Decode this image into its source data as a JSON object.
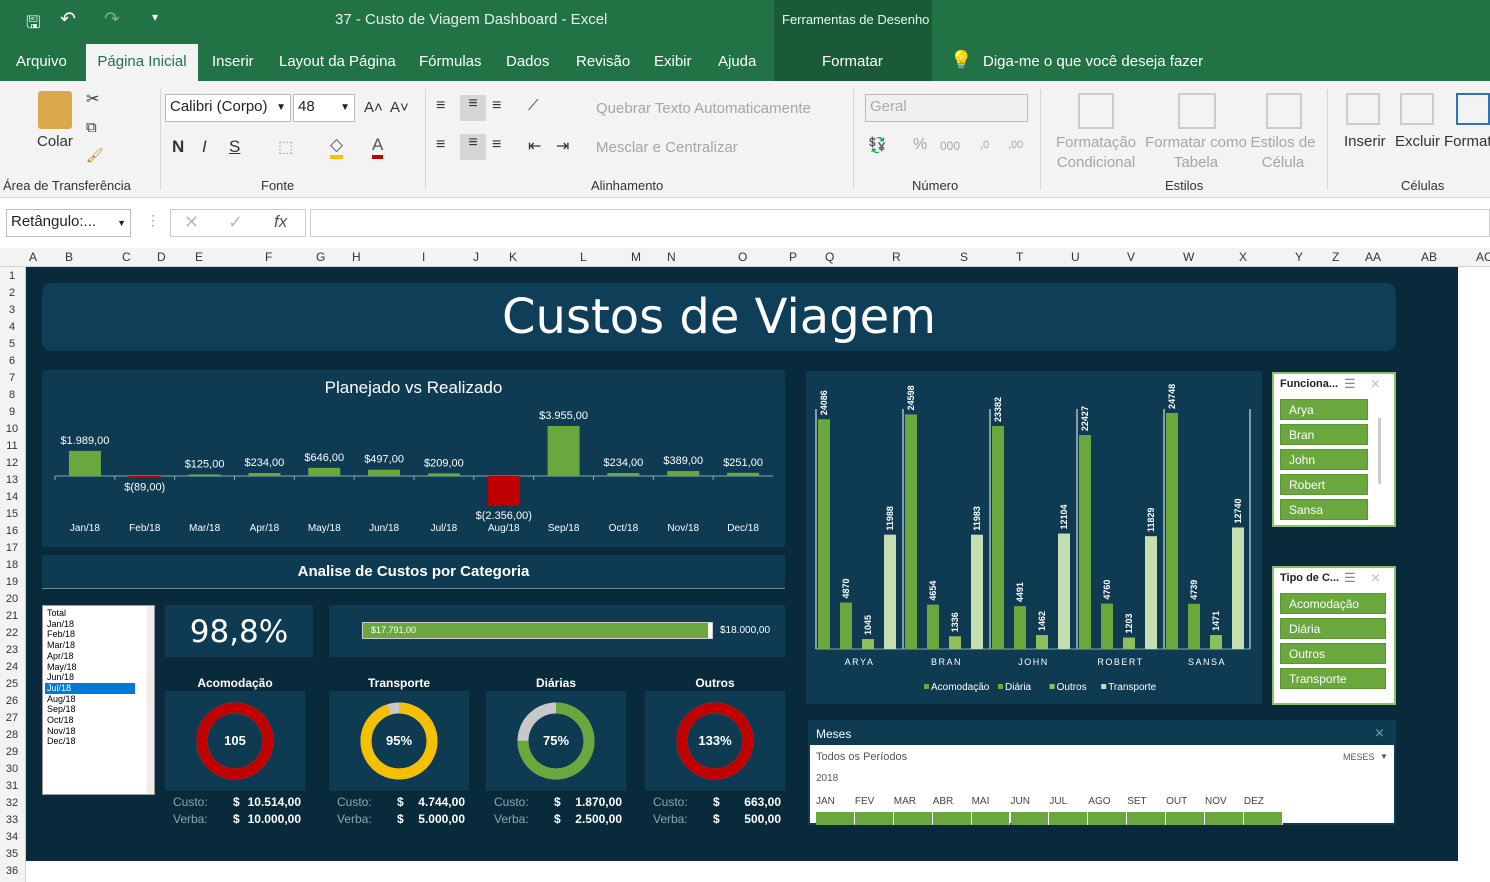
{
  "window": {
    "title": "37 - Custo de Viagem Dashboard  -  Excel",
    "context_tool": "Ferramentas de Desenho"
  },
  "tabs": [
    "Arquivo",
    "Página Inicial",
    "Inserir",
    "Layout da Página",
    "Fórmulas",
    "Dados",
    "Revisão",
    "Exibir",
    "Ajuda",
    "Formatar"
  ],
  "tell_me": "Diga-me o que você deseja fazer",
  "ribbon": {
    "clipboard": {
      "paste": "Colar",
      "label": "Área de Transferência"
    },
    "font": {
      "name": "Calibri (Corpo)",
      "size": "48",
      "label": "Fonte"
    },
    "alignment": {
      "wrap": "Quebrar Texto Automaticamente",
      "merge": "Mesclar e Centralizar",
      "label": "Alinhamento"
    },
    "number": {
      "format": "Geral",
      "label": "Número"
    },
    "styles": {
      "cond": "Formatação Condicional",
      "table": "Formatar como Tabela",
      "cell": "Estilos de Célula",
      "label": "Estilos"
    },
    "cells": {
      "insert": "Inserir",
      "delete": "Excluir",
      "format": "Formatar",
      "label": "Células"
    }
  },
  "namebox": "Retângulo:...",
  "columns": [
    "A",
    "B",
    "C",
    "D",
    "E",
    "F",
    "G",
    "H",
    "I",
    "J",
    "K",
    "L",
    "M",
    "N",
    "O",
    "P",
    "Q",
    "R",
    "S",
    "T",
    "U",
    "V",
    "W",
    "X",
    "Y",
    "Z",
    "AA",
    "AB",
    "AC"
  ],
  "rows": [
    "1",
    "2",
    "3",
    "4",
    "5",
    "6",
    "7",
    "8",
    "9",
    "10",
    "11",
    "12",
    "13",
    "14",
    "15",
    "16",
    "17",
    "18",
    "19",
    "20",
    "21",
    "22",
    "23",
    "24",
    "25",
    "26",
    "27",
    "28",
    "29",
    "30",
    "31",
    "32",
    "33",
    "34",
    "35",
    "36"
  ],
  "dashboard": {
    "title": "Custos de Viagem",
    "section_title": "Analise de Custos por Categoria",
    "percent": "98,8%",
    "progress": {
      "value": "$17.791,00",
      "target": "$18.000,00",
      "fraction": 0.988
    },
    "month_list": [
      "Total",
      "Jan/18",
      "Feb/18",
      "Mar/18",
      "Apr/18",
      "May/18",
      "Jun/18",
      "Jul/18",
      "Aug/18",
      "Sep/18",
      "Oct/18",
      "Nov/18",
      "Dec/18"
    ],
    "selected_month": "Jul/18",
    "gauges": [
      {
        "name": "Acomodação",
        "center": "105",
        "pct": 1.0,
        "color": "#c00000",
        "custo": "10.514,00",
        "verba": "10.000,00"
      },
      {
        "name": "Transporte",
        "center": "95%",
        "pct": 0.95,
        "color": "#f5c000",
        "custo": "4.744,00",
        "verba": "5.000,00"
      },
      {
        "name": "Diárias",
        "center": "75%",
        "pct": 0.75,
        "color": "#6aa83e",
        "custo": "1.870,00",
        "verba": "2.500,00"
      },
      {
        "name": "Outros",
        "center": "133%",
        "pct": 1.0,
        "color": "#c00000",
        "custo": "663,00",
        "verba": "500,00"
      }
    ],
    "custo_label": "Custo:",
    "verba_label": "Verba:",
    "currency": "$"
  },
  "chart_data": [
    {
      "type": "bar",
      "title": "Planejado vs Realizado",
      "categories": [
        "Jan/18",
        "Feb/18",
        "Mar/18",
        "Apr/18",
        "May/18",
        "Jun/18",
        "Jul/18",
        "Aug/18",
        "Sep/18",
        "Oct/18",
        "Nov/18",
        "Dec/18"
      ],
      "values": [
        1989,
        -89,
        125,
        234,
        646,
        497,
        209,
        -2356,
        3955,
        234,
        389,
        251
      ],
      "labels": [
        "$1.989,00",
        "$(89,00)",
        "$125,00",
        "$234,00",
        "$646,00",
        "$497,00",
        "$209,00",
        "$(2.356,00)",
        "$3.955,00",
        "$234,00",
        "$389,00",
        "$251,00"
      ],
      "colors": {
        "positive": "#6aa83e",
        "negative": "#c00000"
      }
    },
    {
      "type": "bar",
      "categories": [
        "ARYA",
        "BRAN",
        "JOHN",
        "ROBERT",
        "SANSA"
      ],
      "series": [
        {
          "name": "Acomodação",
          "values": [
            24086,
            24598,
            23382,
            22427,
            24748
          ],
          "color": "#6aa83e"
        },
        {
          "name": "Diária",
          "values": [
            4870,
            4654,
            4491,
            4760,
            4739
          ],
          "color": "#6aa83e"
        },
        {
          "name": "Outros",
          "values": [
            1045,
            1336,
            1462,
            1203,
            1471
          ],
          "color": "#8dbf5e"
        },
        {
          "name": "Transporte",
          "values": [
            11988,
            11983,
            12104,
            11829,
            12740
          ],
          "color": "#c5dfb0"
        }
      ],
      "ylim": [
        0,
        26000
      ],
      "legend": "bottom"
    }
  ],
  "slicers": {
    "funcionario": {
      "title": "Funciona...",
      "items": [
        "Arya",
        "Bran",
        "John",
        "Robert",
        "Sansa"
      ]
    },
    "tipo": {
      "title": "Tipo de C...",
      "items": [
        "Acomodação",
        "Diária",
        "Outros",
        "Transporte"
      ]
    },
    "meses": {
      "title": "Meses",
      "period": "Todos os Períodos",
      "level": "MESES",
      "year": "2018",
      "months": [
        "JAN",
        "FEV",
        "MAR",
        "ABR",
        "MAI",
        "JUN",
        "JUL",
        "AGO",
        "SET",
        "OUT",
        "NOV",
        "DEZ"
      ]
    }
  }
}
